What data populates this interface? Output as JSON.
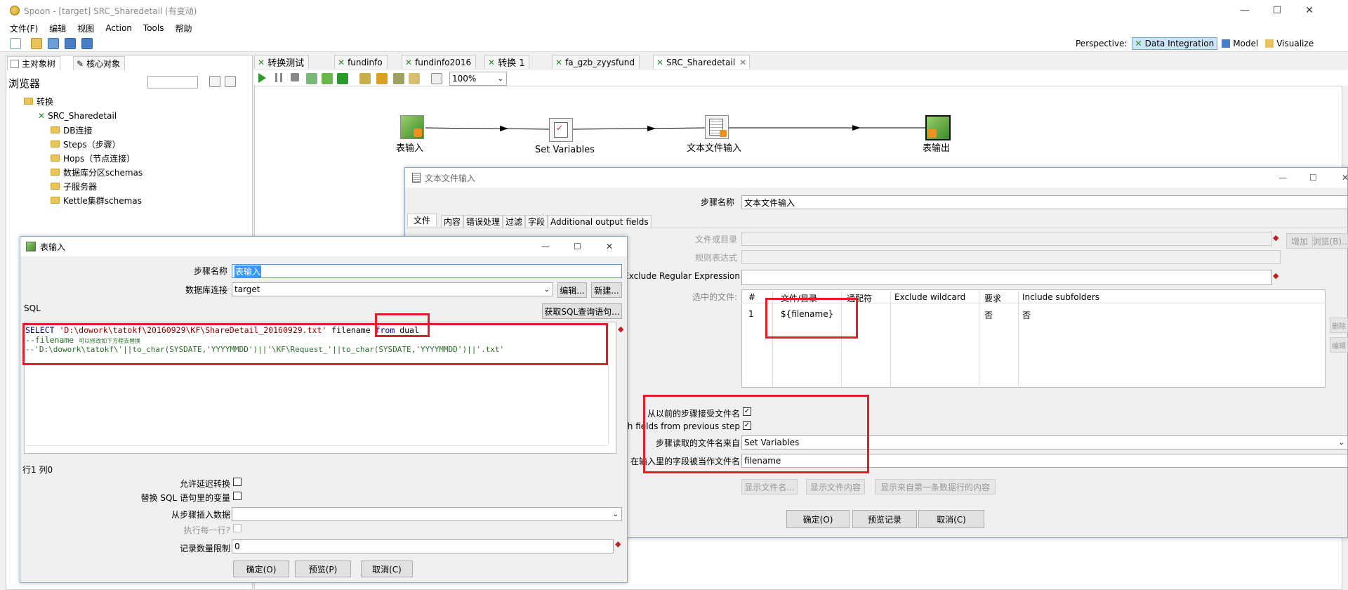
{
  "app": {
    "title": "Spoon - [target] SRC_Sharedetail (有变动)"
  },
  "menu": [
    "文件(F)",
    "编辑",
    "视图",
    "Action",
    "Tools",
    "帮助"
  ],
  "perspective": {
    "label": "Perspective:",
    "items": [
      "Data Integration",
      "Model",
      "Visualize"
    ]
  },
  "left_panel": {
    "tabs": [
      "主对象树",
      "核心对象"
    ],
    "browser_label": "浏览器",
    "tree": [
      "转换",
      "SRC_Sharedetail",
      "DB连接",
      "Steps（步骤）",
      "Hops（节点连接）",
      "数据库分区schemas",
      "子服务器",
      "Kettle集群schemas"
    ]
  },
  "editor_tabs": [
    "转换测试",
    "fundinfo",
    "fundinfo2016",
    "转换 1",
    "fa_gzb_zyysfund",
    "SRC_Sharedetail"
  ],
  "zoom": "100%",
  "canvas": {
    "nodes": [
      "表输入",
      "Set Variables",
      "文本文件输入",
      "表输出"
    ]
  },
  "text_dialog": {
    "title": "文本文件输入",
    "step_name_label": "步骤名称",
    "step_name_value": "文本文件输入",
    "tabs": [
      "文件",
      "内容",
      "错误处理",
      "过滤",
      "字段",
      "Additional output fields"
    ],
    "file_label": "文件或目录",
    "regex_label": "规则表达式",
    "exclude_label": "Exclude Regular Expression",
    "selected_files_label": "选中的文件:",
    "add_btn": "增加",
    "browse_btn": "浏览(B)...",
    "delete_btn": "删除",
    "edit_btn": "编辑",
    "table_headers": [
      "#",
      "文件/目录",
      "通配符",
      "Exclude wildcard",
      "要求",
      "Include subfolders"
    ],
    "table_row": [
      "1",
      "${filename}",
      "",
      "",
      "否",
      "否"
    ],
    "accept_label": "从以前的步骤接受文件名",
    "pass_label": "h fields from previous step",
    "read_from_label": "步骤读取的文件名来自",
    "read_from_value": "Set Variables",
    "field_label": "在输入里的字段被当作文件名",
    "field_value": "filename",
    "show_files_btn": "显示文件名...",
    "show_content_btn": "显示文件内容",
    "show_first_btn": "显示来自第一条数据行的内容",
    "ok_btn": "确定(O)",
    "preview_btn": "预览记录",
    "cancel_btn": "取消(C)"
  },
  "table_dialog": {
    "title": "表输入",
    "step_name_label": "步骤名称",
    "step_name_value": "表输入",
    "db_label": "数据库连接",
    "db_value": "target",
    "edit_btn": "编辑...",
    "new_btn": "新建...",
    "sql_label": "SQL",
    "get_sql_btn": "获取SQL查询语句...",
    "sql_line1_kw": "SELECT",
    "sql_line1_str": "'D:\\dowork\\tatokf\\20160929\\KF\\ShareDetail_20160929.txt'",
    "sql_line1_col": "filename",
    "sql_line1_from": "from",
    "sql_line1_tail": "dual",
    "sql_line2": "--filename",
    "sql_line2_small": "可以修改如下方程去替换",
    "sql_line3": "--'D:\\dowork\\tatokf\\'||to_char(SYSDATE,'YYYYMMDD')||'\\KF\\Request_'||to_char(SYSDATE,'YYYYMMDD')||'.txt'",
    "cursor_pos": "行1 列0",
    "lazy_label": "允许延迟转换",
    "replace_label": "替换 SQL 语句里的变量",
    "insert_from_label": "从步骤插入数据",
    "each_row_label": "执行每一行?",
    "limit_label": "记录数量限制",
    "limit_value": "0",
    "ok_btn": "确定(O)",
    "preview_btn": "预览(P)",
    "cancel_btn": "取消(C)"
  },
  "colors": {
    "highlight": "#e01f2a",
    "sql_keyword": "#00008b",
    "sql_string": "#8b0000",
    "sql_comment": "#2a6b2a"
  }
}
